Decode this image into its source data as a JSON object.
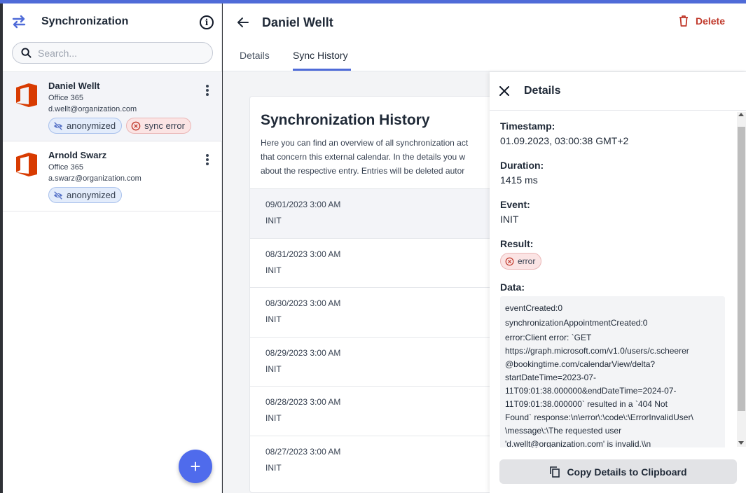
{
  "sidebar": {
    "title": "Synchronization",
    "search_placeholder": "Search...",
    "accounts": [
      {
        "name": "Daniel Wellt",
        "provider": "Office 365",
        "email": "d.wellt@organization.com",
        "badges": [
          "anonymized",
          "sync error"
        ],
        "selected": true
      },
      {
        "name": "Arnold Swarz",
        "provider": "Office 365",
        "email": "a.swarz@organization.com",
        "badges": [
          "anonymized"
        ],
        "selected": false
      }
    ],
    "add_button": "+"
  },
  "header": {
    "title": "Daniel Wellt",
    "delete_label": "Delete",
    "tabs": [
      "Details",
      "Sync History"
    ],
    "active_tab": "Sync History"
  },
  "history": {
    "title": "Synchronization History",
    "description_lines": [
      "Here you can find an overview of all synchronization act",
      "that concern this external calendar. In the details you w",
      "about the respective entry. Entries will be deleted autor"
    ],
    "entries": [
      {
        "date": "09/01/2023 3:00 AM",
        "event": "INIT"
      },
      {
        "date": "08/31/2023 3:00 AM",
        "event": "INIT"
      },
      {
        "date": "08/30/2023 3:00 AM",
        "event": "INIT"
      },
      {
        "date": "08/29/2023 3:00 AM",
        "event": "INIT"
      },
      {
        "date": "08/28/2023 3:00 AM",
        "event": "INIT"
      },
      {
        "date": "08/27/2023 3:00 AM",
        "event": "INIT"
      }
    ]
  },
  "details": {
    "title": "Details",
    "timestamp_label": "Timestamp:",
    "timestamp": "01.09.2023, 03:00:38 GMT+2",
    "duration_label": "Duration:",
    "duration": "1415 ms",
    "event_label": "Event:",
    "event": "INIT",
    "result_label": "Result:",
    "result": "error",
    "data_label": "Data:",
    "data_lines": [
      "eventCreated:0",
      "synchronizationAppointmentCreated:0",
      "error:Client error: `GET\nhttps://graph.microsoft.com/v1.0/users/c.scheerer\n@bookingtime.com/calendarView/delta?\nstartDateTime=2023-07-\n11T09:01:38.000000&endDateTime=2024-07-\n11T09:01:38.000000` resulted in a `404 Not\nFound` response:\\n\\error\\:\\code\\:\\ErrorInvalidUser\\\n\\message\\:\\The requested user\n'd.wellt@organization.com' is invalid.\\\\n"
    ],
    "copy_label": "Copy Details to Clipboard"
  },
  "colors": {
    "accent": "#4f6bd8",
    "danger": "#c0392b",
    "office_orange": "#d83b01"
  }
}
